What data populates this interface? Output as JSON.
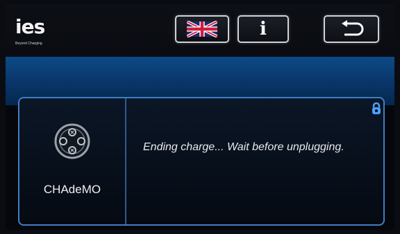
{
  "header": {
    "logo_text": "ies",
    "logo_subtitle": "Beyond Charging",
    "language_button": {
      "icon": "uk-flag-icon"
    },
    "info_button": {
      "icon": "info-icon",
      "label": "i"
    },
    "back_button": {
      "icon": "return-arrow-icon"
    }
  },
  "connector": {
    "name": "CHAdeMO",
    "icon": "chademo-connector-icon"
  },
  "status": {
    "message": "Ending charge... Wait before unplugging.",
    "icon": "lock-status-icon",
    "icon_color": "#4aa3ff"
  },
  "colors": {
    "accent_blue": "#0c4a86",
    "panel_border": "#3f7fc3",
    "background": "#05070c"
  }
}
